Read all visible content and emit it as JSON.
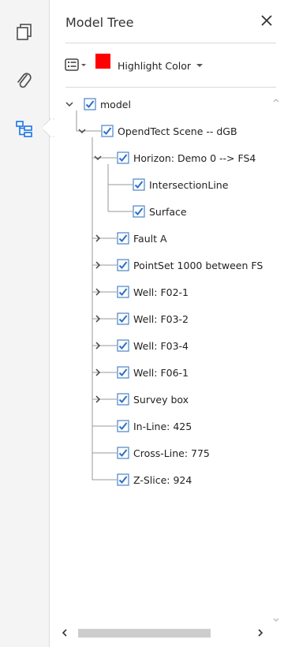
{
  "rail": [
    {
      "name": "pages-icon"
    },
    {
      "name": "attachment-icon"
    },
    {
      "name": "model-tree-icon"
    }
  ],
  "panel": {
    "title": "Model Tree",
    "close_glyph": "✕",
    "toolbar": {
      "highlight_label": "Highlight Color",
      "highlight_color": "#ff0000"
    }
  },
  "tree": [
    {
      "label": "model",
      "expanded": true,
      "checked": true,
      "level": 0
    },
    {
      "label": "OpendTect Scene -- dGB",
      "expanded": true,
      "checked": true,
      "level": 1
    },
    {
      "label": "Horizon: Demo 0 --> FS4",
      "expanded": true,
      "checked": true,
      "level": 2
    },
    {
      "label": "IntersectionLine",
      "checked": true,
      "level": 3
    },
    {
      "label": "Surface",
      "checked": true,
      "level": 3
    },
    {
      "label": "Fault A",
      "expanded": false,
      "checked": true,
      "level": 2
    },
    {
      "label": "PointSet 1000 between FS",
      "expanded": false,
      "checked": true,
      "level": 2
    },
    {
      "label": "Well: F02-1",
      "expanded": false,
      "checked": true,
      "level": 2
    },
    {
      "label": "Well: F03-2",
      "expanded": false,
      "checked": true,
      "level": 2
    },
    {
      "label": "Well: F03-4",
      "expanded": false,
      "checked": true,
      "level": 2
    },
    {
      "label": "Well: F06-1",
      "expanded": false,
      "checked": true,
      "level": 2
    },
    {
      "label": "Survey box",
      "expanded": false,
      "checked": true,
      "level": 2
    },
    {
      "label": "In-Line: 425",
      "checked": true,
      "level": 2
    },
    {
      "label": "Cross-Line: 775",
      "checked": true,
      "level": 2
    },
    {
      "label": "Z-Slice: 924",
      "checked": true,
      "level": 2
    }
  ],
  "scrollbar": {
    "up": "^",
    "down": "v",
    "left": "<",
    "right": ">"
  }
}
